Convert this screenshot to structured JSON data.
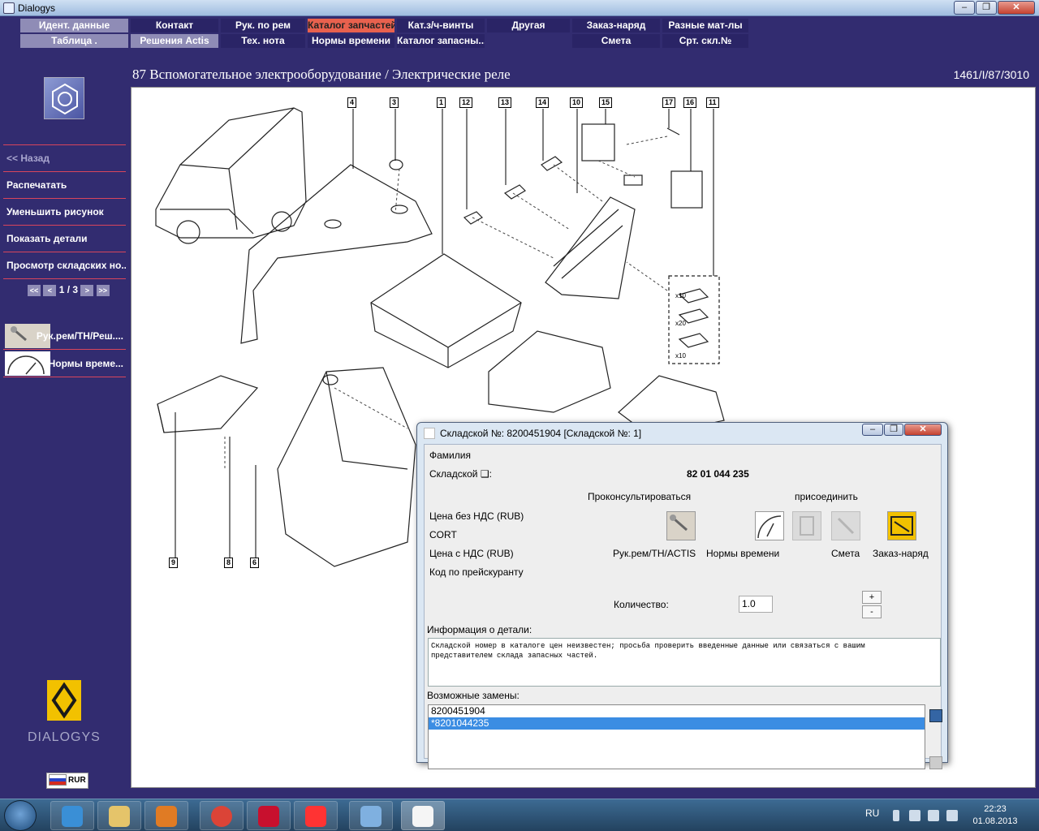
{
  "window": {
    "title": "Dialogys"
  },
  "top_menu": {
    "row1": [
      "Идент. данные",
      "Контакт",
      "Рук. по рем",
      "Каталог запчастей",
      "Кат.з/ч-винты",
      "Другая",
      "Заказ-наряд",
      "Разные мат-лы"
    ],
    "row2": [
      "Таблица .",
      "Решения Actis",
      "Тех. нота",
      "Нормы времени",
      "Каталог запасны...",
      "",
      "Смета",
      "Срт. скл.№"
    ]
  },
  "header": {
    "title": "87 Вспомогательное электрооборудование / Электрические реле",
    "reference": "1461/I/87/3010"
  },
  "sidebar": {
    "back": "<< Назад",
    "items": [
      "Распечатать",
      "Уменьшить рисунок",
      "Показать детали",
      "Просмотр складских но..."
    ],
    "pager": {
      "first": "<<",
      "prev": "<",
      "current": "1",
      "sep": " / ",
      "total": "3",
      "next": ">",
      "last": ">>"
    },
    "tools": [
      {
        "label": "Рук.рем/TH/Реш....",
        "icon": "wrench-thumb-icon"
      },
      {
        "label": "Нормы време...",
        "icon": "gauge-thumb-icon"
      }
    ],
    "brand": "DIALOGYS",
    "currency": "RUR"
  },
  "drawing": {
    "callouts": [
      "4",
      "3",
      "1",
      "12",
      "13",
      "14",
      "10",
      "15",
      "17",
      "16",
      "11",
      "9",
      "8",
      "6"
    ],
    "multipliers": [
      "x10",
      "x20",
      "x10"
    ]
  },
  "dialog": {
    "title": "Складской №: 8200451904 [Складской №: 1]",
    "labels": {
      "surname": "Фамилия",
      "part_no": "Складской ❑:",
      "price_excl": "Цена без НДС (RUB)",
      "cort": "CORT",
      "price_incl": "Цена с НДС (RUB)",
      "price_code": "Код по прейскуранту",
      "consult": "Проконсультироваться",
      "attach": "присоединить",
      "quantity": "Количество:",
      "info": "Информация о детали:",
      "replacements": "Возможные замены:"
    },
    "part_number_value": "82 01 044 235",
    "buttons": [
      "Рук.рем/TH/ACTIS",
      "Нормы времени",
      "Смета",
      "Заказ-наряд"
    ],
    "quantity_value": "1.0",
    "spin_plus": "+",
    "spin_minus": "-",
    "info_text": "Складской номер в каталоге цен неизвестен; просьба проверить введенные данные или связаться с вашим представителем склада запасных частей.",
    "replacement_list": [
      "8200451904",
      "*8201044235"
    ],
    "selected_index": 1
  },
  "taskbar": {
    "lang": "RU",
    "time": "22:23",
    "date": "01.08.2013"
  },
  "colors": {
    "background": "#322c70",
    "menu_gray": "#8f8cb6",
    "menu_active": "#e8614e",
    "sidebar_divider": "#d8455c",
    "list_selected": "#3b8de3"
  }
}
